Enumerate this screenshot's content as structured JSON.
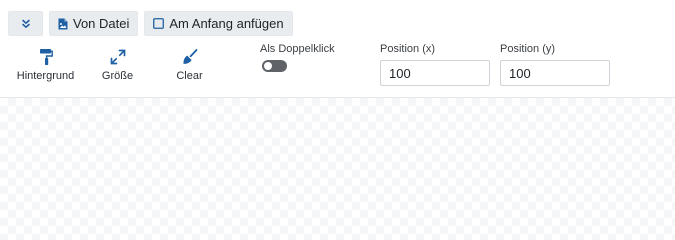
{
  "toolbar": {
    "collapse_icon": "chevrons-down-icon",
    "from_file_label": "Von Datei",
    "from_file_icon": "file-image-icon",
    "append_label": "Am Anfang anfügen",
    "append_icon": "checkbox-icon",
    "append_checked": false
  },
  "tools": [
    {
      "label": "Hintergrund",
      "icon": "paint-roller-icon"
    },
    {
      "label": "Größe",
      "icon": "expand-arrows-icon"
    },
    {
      "label": "Clear",
      "icon": "broom-icon"
    }
  ],
  "options": {
    "double_click_label": "Als Doppelklick",
    "double_click_enabled": false,
    "position_x_label": "Position (x)",
    "position_x_value": "100",
    "position_y_label": "Position (y)",
    "position_y_value": "100"
  },
  "colors": {
    "accent": "#1f5fa3",
    "button_bg": "#e9ecef",
    "toggle_off": "#5f6368"
  }
}
